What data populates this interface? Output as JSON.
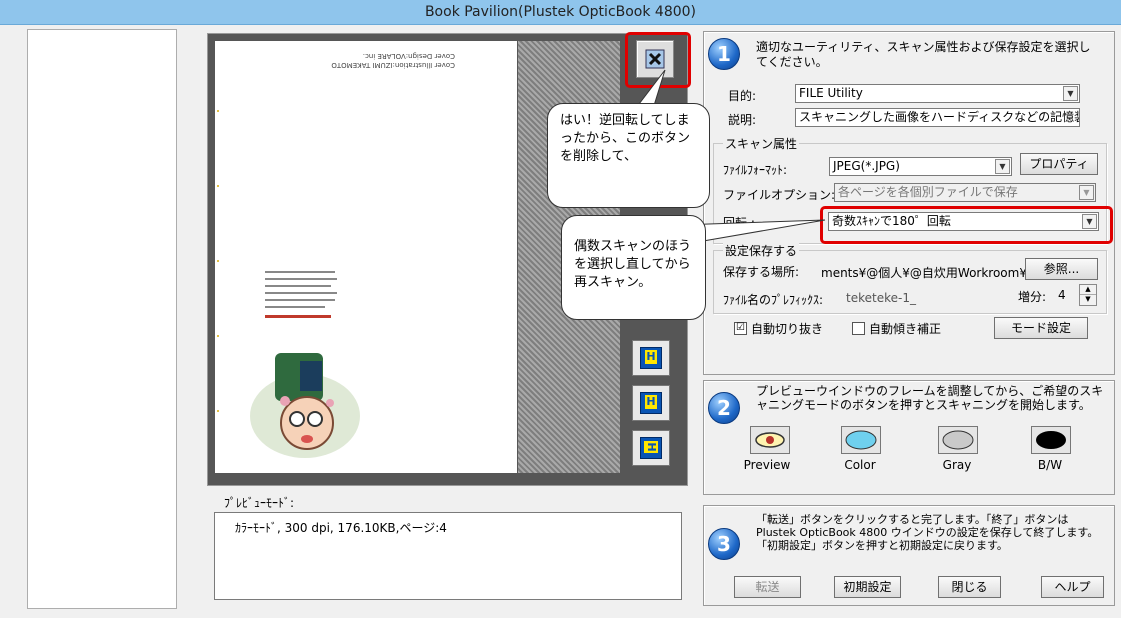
{
  "window": {
    "title": "Book Pavilion(Plustek OpticBook 4800)"
  },
  "preview": {
    "mode_label": "ﾌﾟﾚﾋﾞｭｰﾓｰﾄﾞ:",
    "info": "ｶﾗｰﾓｰﾄﾞ,  300 dpi,  176.10KB,ページ:4",
    "page_credit_line1": "Cover Illustration:IZUMI TAKEMOTO",
    "page_credit_line2": "Cover Design:VOLARE inc."
  },
  "callouts": {
    "bubble1": "はい！逆回転してしまったから、このボタンを削除して、",
    "bubble2": "偶数スキャンのほうを選択し直してから再スキャン。"
  },
  "step1": {
    "number": "1",
    "instruction": "適切なユーティリティ、スキャン属性および保存設定を選択してください。",
    "purpose_label": "目的:",
    "purpose_value": "FILE Utility",
    "description_label": "説明:",
    "description_value": "スキャニングした画像をハードディスクなどの記憶装置",
    "scan_attr_title": "スキャン属性",
    "file_format_label": "ﾌｧｲﾙﾌｫｰﾏｯﾄ:",
    "file_format_value": "JPEG(*.JPG)",
    "properties_button": "プロパティ",
    "file_option_label": "ファイルオプション:",
    "file_option_value": "各ページを各個別ファイルで保存",
    "rotation_label": "回転 :",
    "rotation_value": "奇数ｽｷｬﾝで180゜回転",
    "save_title": "設定保存する",
    "save_location_label": "保存する場所:",
    "save_location_value": "ments¥@個人¥@自炊用Workroom¥",
    "browse_button": "参照...",
    "filename_prefix_label": "ﾌｧｲﾙ名のﾌﾟﾚﾌｨｯｸｽ:",
    "filename_prefix_value": "teketeke-1_",
    "increment_label": "増分:",
    "increment_value": "4",
    "auto_crop_label": "自動切り抜き",
    "auto_crop_checked": "☑",
    "auto_deskew_label": "自動傾き補正",
    "mode_settings_button": "モード設定"
  },
  "step2": {
    "number": "2",
    "instruction": "プレビューウインドウのフレームを調整してから、ご希望のスキャニングモードのボタンを押すとスキャニングを開始します。",
    "buttons": {
      "preview": "Preview",
      "color": "Color",
      "gray": "Gray",
      "bw": "B/W"
    }
  },
  "step3": {
    "number": "3",
    "instruction": "「転送」ボタンをクリックすると完了します。「終了」ボタンは Plustek OpticBook 4800 ウインドウの設定を保存して終了します。「初期設定」ボタンを押すと初期設定に戻ります。",
    "transfer_button": "転送",
    "defaults_button": "初期設定",
    "close_button": "閉じる",
    "help_button": "ヘルプ"
  },
  "colors": {
    "accent_red": "#e00000",
    "title_bar": "#8fc5ec",
    "step_blue": "#1e68c8"
  }
}
